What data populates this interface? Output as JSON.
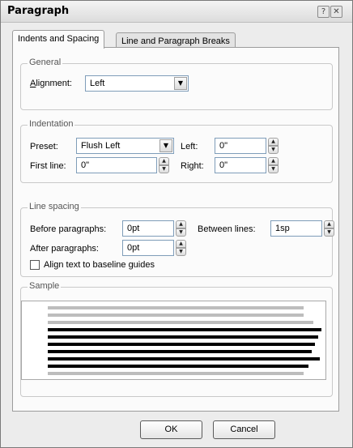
{
  "window": {
    "title": "Paragraph",
    "help_icon": "question-mark",
    "close_icon": "x"
  },
  "tabs": [
    {
      "label": "Indents and Spacing",
      "active": true
    },
    {
      "label": "Line and Paragraph Breaks",
      "active": false
    }
  ],
  "general": {
    "legend": "General",
    "alignment_label": "Alignment:",
    "alignment_value": "Left"
  },
  "indentation": {
    "legend": "Indentation",
    "preset_label": "Preset:",
    "preset_value": "Flush Left",
    "left_label": "Left:",
    "left_value": "0\"",
    "first_line_label": "First line:",
    "first_line_value": "0\"",
    "right_label": "Right:",
    "right_value": "0\""
  },
  "line_spacing": {
    "legend": "Line spacing",
    "before_label": "Before paragraphs:",
    "before_value": "0pt",
    "between_label": "Between lines:",
    "between_value": "1sp",
    "after_label": "After paragraphs:",
    "after_value": "0pt",
    "baseline_label": "Align text to baseline guides",
    "baseline_checked": false
  },
  "sample": {
    "legend": "Sample",
    "line_colors": {
      "preview_gray": "#bdbdbd",
      "paragraph_black": "#000000"
    }
  },
  "buttons": {
    "ok": "OK",
    "cancel": "Cancel"
  }
}
